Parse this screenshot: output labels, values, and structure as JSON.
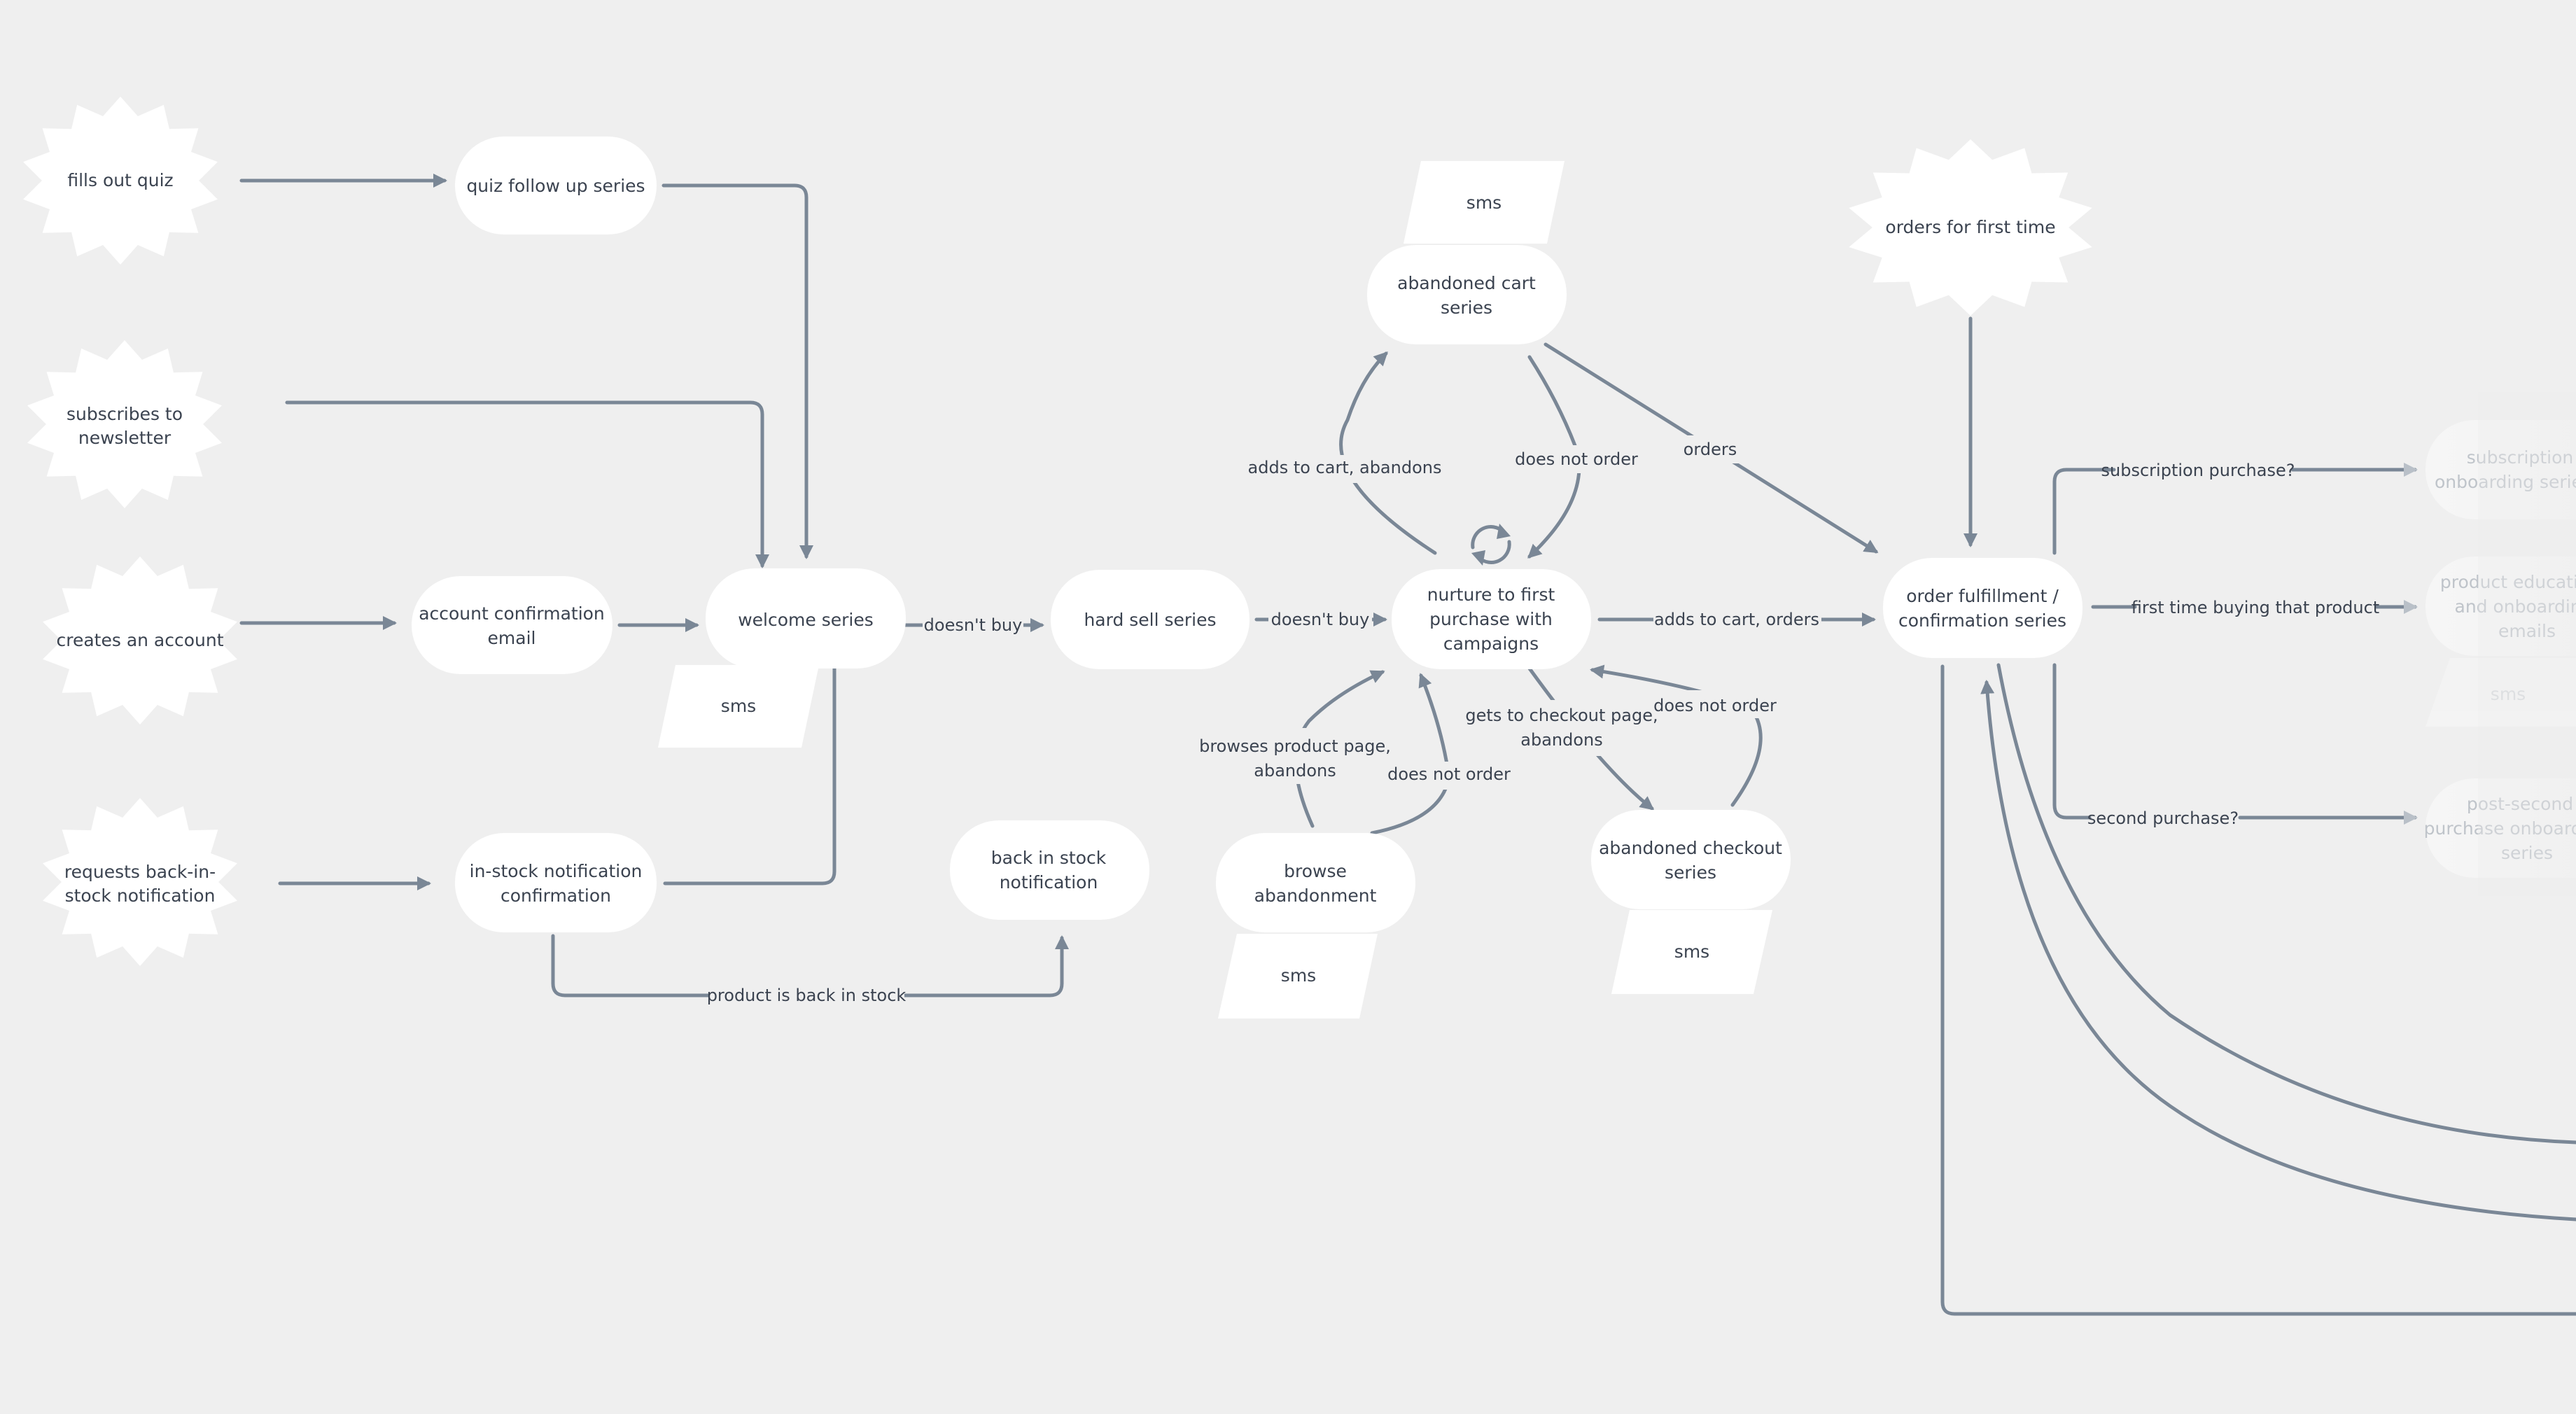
{
  "colors": {
    "background": "#efefef",
    "node_fill": "#ffffff",
    "edge": "#7a8796",
    "text": "#3b4350",
    "faded_text": "#bfc4ca"
  },
  "triggers": {
    "quiz": [
      "fills out quiz"
    ],
    "newsletter": [
      "subscribes to",
      "newsletter"
    ],
    "account": [
      "creates an account"
    ],
    "back_in_stock_request": [
      "requests back-in-",
      "stock notification"
    ],
    "first_order": [
      "orders for first time"
    ]
  },
  "flows": {
    "quiz_follow_up": [
      "quiz follow up series"
    ],
    "account_confirmation": [
      "account confirmation",
      "email"
    ],
    "welcome": [
      "welcome series"
    ],
    "in_stock_confirmation": [
      "in-stock notification",
      "confirmation"
    ],
    "back_in_stock": [
      "back in stock",
      "notification"
    ],
    "hard_sell": [
      "hard sell series"
    ],
    "nurture": [
      "nurture to first",
      "purchase with",
      "campaigns"
    ],
    "abandoned_cart": [
      "abandoned cart",
      "series"
    ],
    "browse_abandonment": [
      "browse",
      "abandonment"
    ],
    "abandoned_checkout": [
      "abandoned checkout",
      "series"
    ],
    "order_fulfillment": [
      "order fulfillment /",
      "confirmation series"
    ],
    "subscription_onboarding": [
      "subscription",
      "onboarding series"
    ],
    "product_education": [
      "product education",
      "and onboarding",
      "emails"
    ],
    "post_second_purchase": [
      "post-second",
      "purchase onboarding",
      "series"
    ]
  },
  "sms": {
    "label": "sms"
  },
  "edge_labels": {
    "doesnt_buy_1": "doesn't buy",
    "doesnt_buy_2": "doesn't buy",
    "product_back_in_stock": "product is back in stock",
    "adds_to_cart_abandons": "adds to cart, abandons",
    "does_not_order_cart": "does not order",
    "orders": "orders",
    "adds_to_cart_orders": "adds to cart, orders",
    "browses_product_page": [
      "browses product page,",
      "abandons"
    ],
    "does_not_order_browse": "does not order",
    "gets_to_checkout": [
      "gets to checkout page,",
      "abandons"
    ],
    "does_not_order_checkout": "does not order",
    "subscription_purchase": "subscription purchase?",
    "first_time_buying": "first time buying that product",
    "second_purchase": "second purchase?"
  },
  "icons": {
    "loop": "refresh-cycle-icon"
  }
}
